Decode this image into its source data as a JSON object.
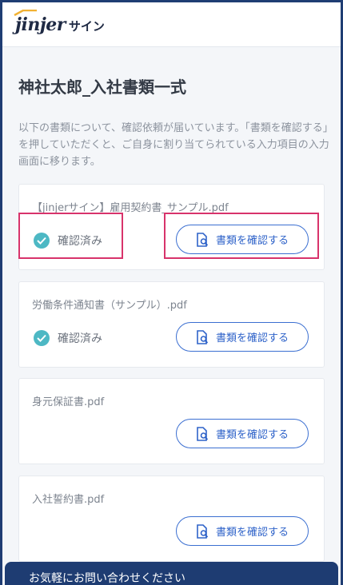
{
  "header": {
    "logo_main": "jinjer",
    "logo_sub": "サイン"
  },
  "page": {
    "title": "神社太郎_入社書類一式",
    "description": "以下の書類について、確認依頼が届いています。「書類を確認する」を押していただくと、ご自身に割り当てられている入力項目の入力画面に移ります。"
  },
  "documents": [
    {
      "name": "【jinjerサイン】雇用契約書_サンプル.pdf",
      "status": "確認済み",
      "button": "書類を確認する"
    },
    {
      "name": "労働条件通知書（サンプル）.pdf",
      "status": "確認済み",
      "button": "書類を確認する"
    },
    {
      "name": "身元保証書.pdf",
      "status": "",
      "button": "書類を確認する"
    },
    {
      "name": "入社誓約書.pdf",
      "status": "",
      "button": "書類を確認する"
    }
  ],
  "footer": {
    "text": "お気軽にお問い合わせください"
  },
  "colors": {
    "accent": "#3b6fd1",
    "check": "#4db8c4",
    "highlight": "#d8336b",
    "footer": "#1e3c72"
  },
  "icons": {
    "check": "check-circle-icon",
    "document": "document-search-icon"
  }
}
